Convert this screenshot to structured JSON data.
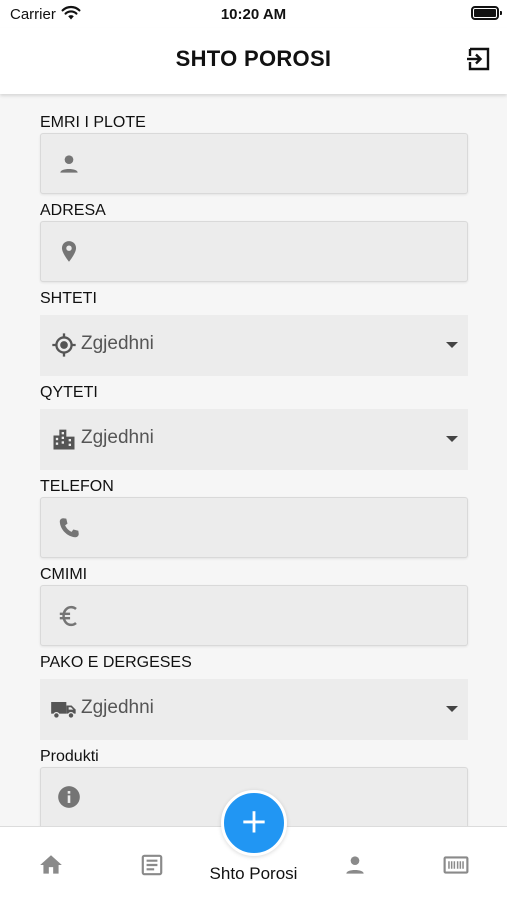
{
  "status_bar": {
    "carrier": "Carrier",
    "time": "10:20 AM"
  },
  "header": {
    "title": "SHTO POROSI",
    "logout_icon": "logout-icon"
  },
  "form": {
    "full_name": {
      "label": "EMRI I PLOTE",
      "value": "",
      "icon": "person-icon"
    },
    "address": {
      "label": "ADRESA",
      "value": "",
      "icon": "location-pin-icon"
    },
    "country": {
      "label": "SHTETI",
      "selected": "Zgjedhni",
      "icon": "gps-target-icon"
    },
    "city": {
      "label": "QYTETI",
      "selected": "Zgjedhni",
      "icon": "city-icon"
    },
    "phone": {
      "label": "TELEFON",
      "value": "",
      "icon": "phone-icon"
    },
    "price": {
      "label": "CMIMI",
      "value": "",
      "icon": "euro-icon"
    },
    "delivery_package": {
      "label": "PAKO E DERGESES",
      "selected": "Zgjedhni",
      "icon": "truck-icon"
    },
    "product": {
      "label": "Produkti",
      "value": "",
      "icon": "info-icon"
    }
  },
  "tabbar": {
    "fab_label": "Shto Porosi",
    "fab_icon": "plus-icon",
    "tabs": [
      "home-icon",
      "list-icon",
      "profile-icon",
      "barcode-icon"
    ]
  },
  "colors": {
    "accent": "#2196f3",
    "field_background": "#ececec",
    "page_background": "#f6f6f6"
  }
}
